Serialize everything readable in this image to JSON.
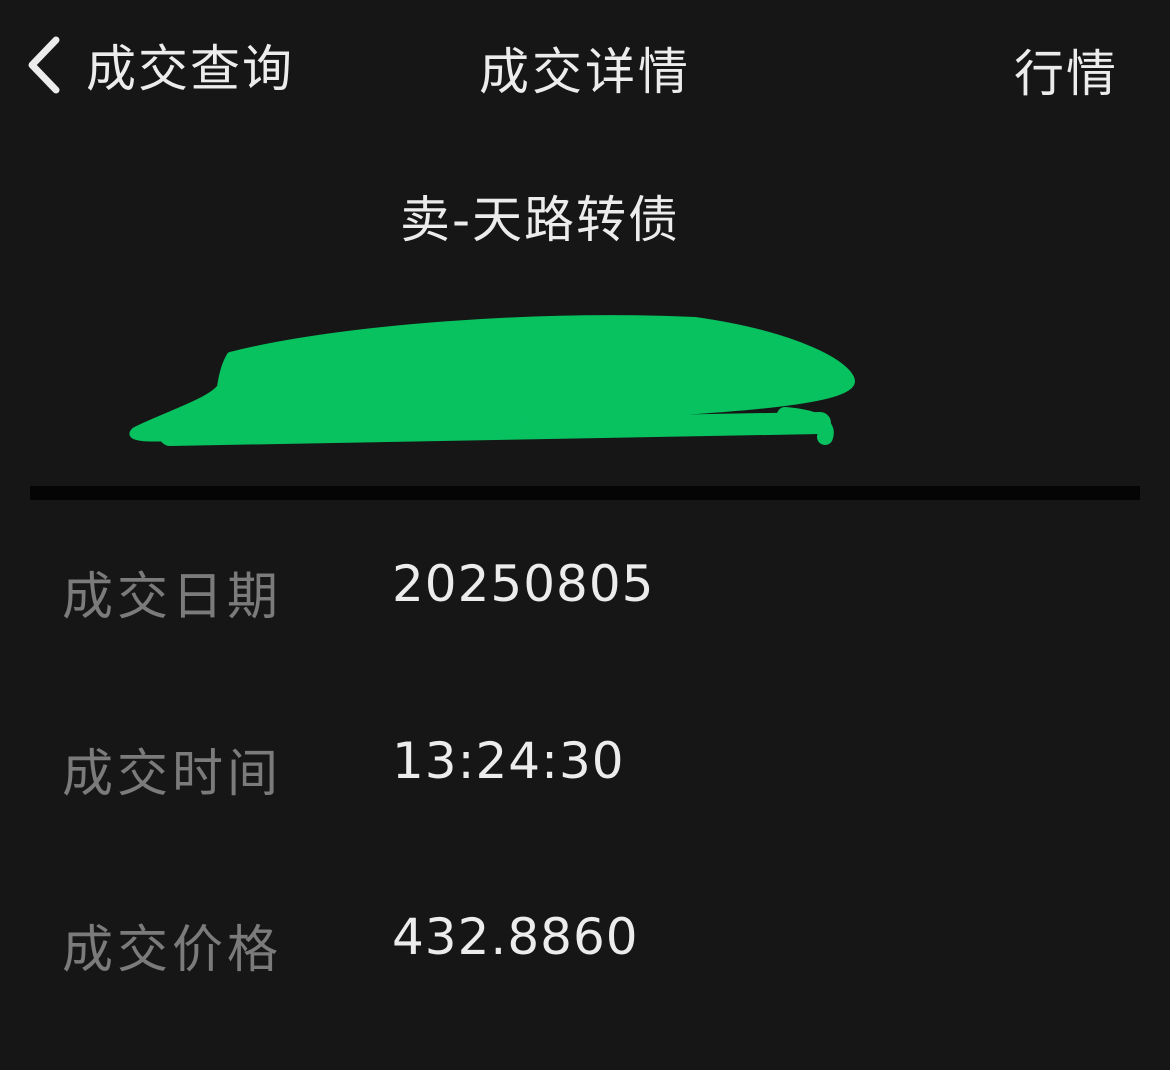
{
  "nav": {
    "back_label": "成交查询",
    "title": "成交详情",
    "right_label": "行情",
    "back_icon": "chevron-left-icon"
  },
  "trade": {
    "title": "卖-天路转债"
  },
  "details": [
    {
      "label": "成交日期",
      "value": "20250805"
    },
    {
      "label": "成交时间",
      "value": "13:24:30"
    },
    {
      "label": "成交价格",
      "value": "432.8860"
    }
  ],
  "colors": {
    "background": "#161616",
    "text": "#ececec",
    "label": "#7b7b7b",
    "divider": "#050505",
    "redaction": "#08c260"
  }
}
